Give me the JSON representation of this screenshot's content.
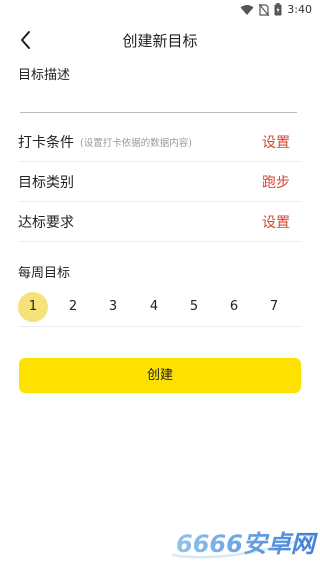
{
  "status_bar": {
    "time": "3:40"
  },
  "nav": {
    "title": "创建新目标"
  },
  "description": {
    "label": "目标描述",
    "value": ""
  },
  "rows": [
    {
      "label": "打卡条件",
      "hint": "(设置打卡依据的数据内容)",
      "value": "设置"
    },
    {
      "label": "目标类别",
      "hint": "",
      "value": "跑步"
    },
    {
      "label": "达标要求",
      "hint": "",
      "value": "设置"
    }
  ],
  "weekly": {
    "label": "每周目标",
    "days": [
      "1",
      "2",
      "3",
      "4",
      "5",
      "6",
      "7"
    ],
    "selected": "1"
  },
  "create_button": {
    "label": "创建"
  },
  "watermark": {
    "text": "6666安卓网"
  },
  "colors": {
    "accent_yellow": "#ffe100",
    "selected_circle": "#f5e27a",
    "value_red": "#d8442e"
  }
}
